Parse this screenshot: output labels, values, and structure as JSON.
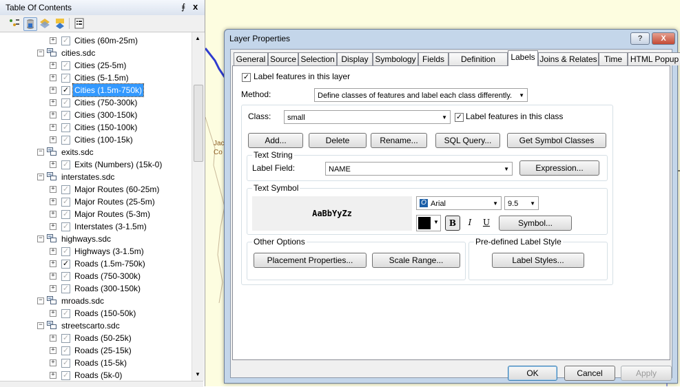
{
  "toc": {
    "title": "Table Of Contents",
    "pin_glyph": "⨎",
    "close_glyph": "x",
    "checked_glyph": "✓",
    "rows": [
      {
        "type": "layer",
        "label": "Cities (60m-25m)",
        "checked": false
      },
      {
        "type": "group",
        "label": "cities.sdc"
      },
      {
        "type": "layer",
        "label": "Cities (25-5m)",
        "checked": false
      },
      {
        "type": "layer",
        "label": "Cities (5-1.5m)",
        "checked": false
      },
      {
        "type": "layer",
        "label": "Cities (1.5m-750k)",
        "checked": true,
        "selected": true
      },
      {
        "type": "layer",
        "label": "Cities (750-300k)",
        "checked": false
      },
      {
        "type": "layer",
        "label": "Cities (300-150k)",
        "checked": false
      },
      {
        "type": "layer",
        "label": "Cities (150-100k)",
        "checked": false
      },
      {
        "type": "layer",
        "label": "Cities (100-15k)",
        "checked": false
      },
      {
        "type": "group",
        "label": "exits.sdc"
      },
      {
        "type": "layer",
        "label": "Exits (Numbers) (15k-0)",
        "checked": false
      },
      {
        "type": "group",
        "label": "interstates.sdc"
      },
      {
        "type": "layer",
        "label": "Major Routes (60-25m)",
        "checked": false
      },
      {
        "type": "layer",
        "label": "Major Routes (25-5m)",
        "checked": false
      },
      {
        "type": "layer",
        "label": "Major Routes (5-3m)",
        "checked": false
      },
      {
        "type": "layer",
        "label": "Interstates (3-1.5m)",
        "checked": false
      },
      {
        "type": "group",
        "label": "highways.sdc"
      },
      {
        "type": "layer",
        "label": "Highways (3-1.5m)",
        "checked": false
      },
      {
        "type": "layer",
        "label": "Roads (1.5m-750k)",
        "checked": true
      },
      {
        "type": "layer",
        "label": "Roads (750-300k)",
        "checked": false
      },
      {
        "type": "layer",
        "label": "Roads (300-150k)",
        "checked": false
      },
      {
        "type": "group",
        "label": "mroads.sdc"
      },
      {
        "type": "layer",
        "label": "Roads (150-50k)",
        "checked": false
      },
      {
        "type": "group",
        "label": "streetscarto.sdc"
      },
      {
        "type": "layer",
        "label": "Roads (50-25k)",
        "checked": false
      },
      {
        "type": "layer",
        "label": "Roads (25-15k)",
        "checked": false
      },
      {
        "type": "layer",
        "label": "Roads (15-5k)",
        "checked": false
      },
      {
        "type": "layer",
        "label": "Roads (5k-0)",
        "checked": false
      }
    ]
  },
  "map": {
    "label_lines": [
      "Jac",
      "Co"
    ],
    "road_color": "#2f3ccf",
    "background_color": "#fdfde0"
  },
  "dialog": {
    "title": "Layer Properties",
    "help_glyph": "?",
    "close_glyph": "X",
    "tabs": [
      "General",
      "Source",
      "Selection",
      "Display",
      "Symbology",
      "Fields",
      "Definition Query",
      "Labels",
      "Joins & Relates",
      "Time",
      "HTML Popup"
    ],
    "active_tab": "Labels",
    "label_features_layer": "Label features in this layer",
    "method_label": "Method:",
    "method_value": "Define classes of features and label each class differently.",
    "class_label": "Class:",
    "class_value": "small",
    "label_features_class": "Label features in this class",
    "buttons_row": {
      "add": "Add...",
      "delete": "Delete",
      "rename": "Rename...",
      "sql": "SQL Query...",
      "symbol_classes": "Get Symbol Classes"
    },
    "text_string": {
      "header": "Text String",
      "field_label": "Label Field:",
      "field_value": "NAME",
      "expression": "Expression..."
    },
    "text_symbol": {
      "header": "Text Symbol",
      "preview": "AaBbYyZz",
      "font": "Arial",
      "size": "9.5",
      "bold": "B",
      "italic": "I",
      "underline": "U",
      "symbol": "Symbol...",
      "font_icon": "O"
    },
    "other_options": {
      "header": "Other Options",
      "placement": "Placement Properties...",
      "scale": "Scale Range..."
    },
    "predefined": {
      "header": "Pre-defined Label Style",
      "styles": "Label Styles..."
    },
    "footer": {
      "ok": "OK",
      "cancel": "Cancel",
      "apply": "Apply"
    }
  }
}
